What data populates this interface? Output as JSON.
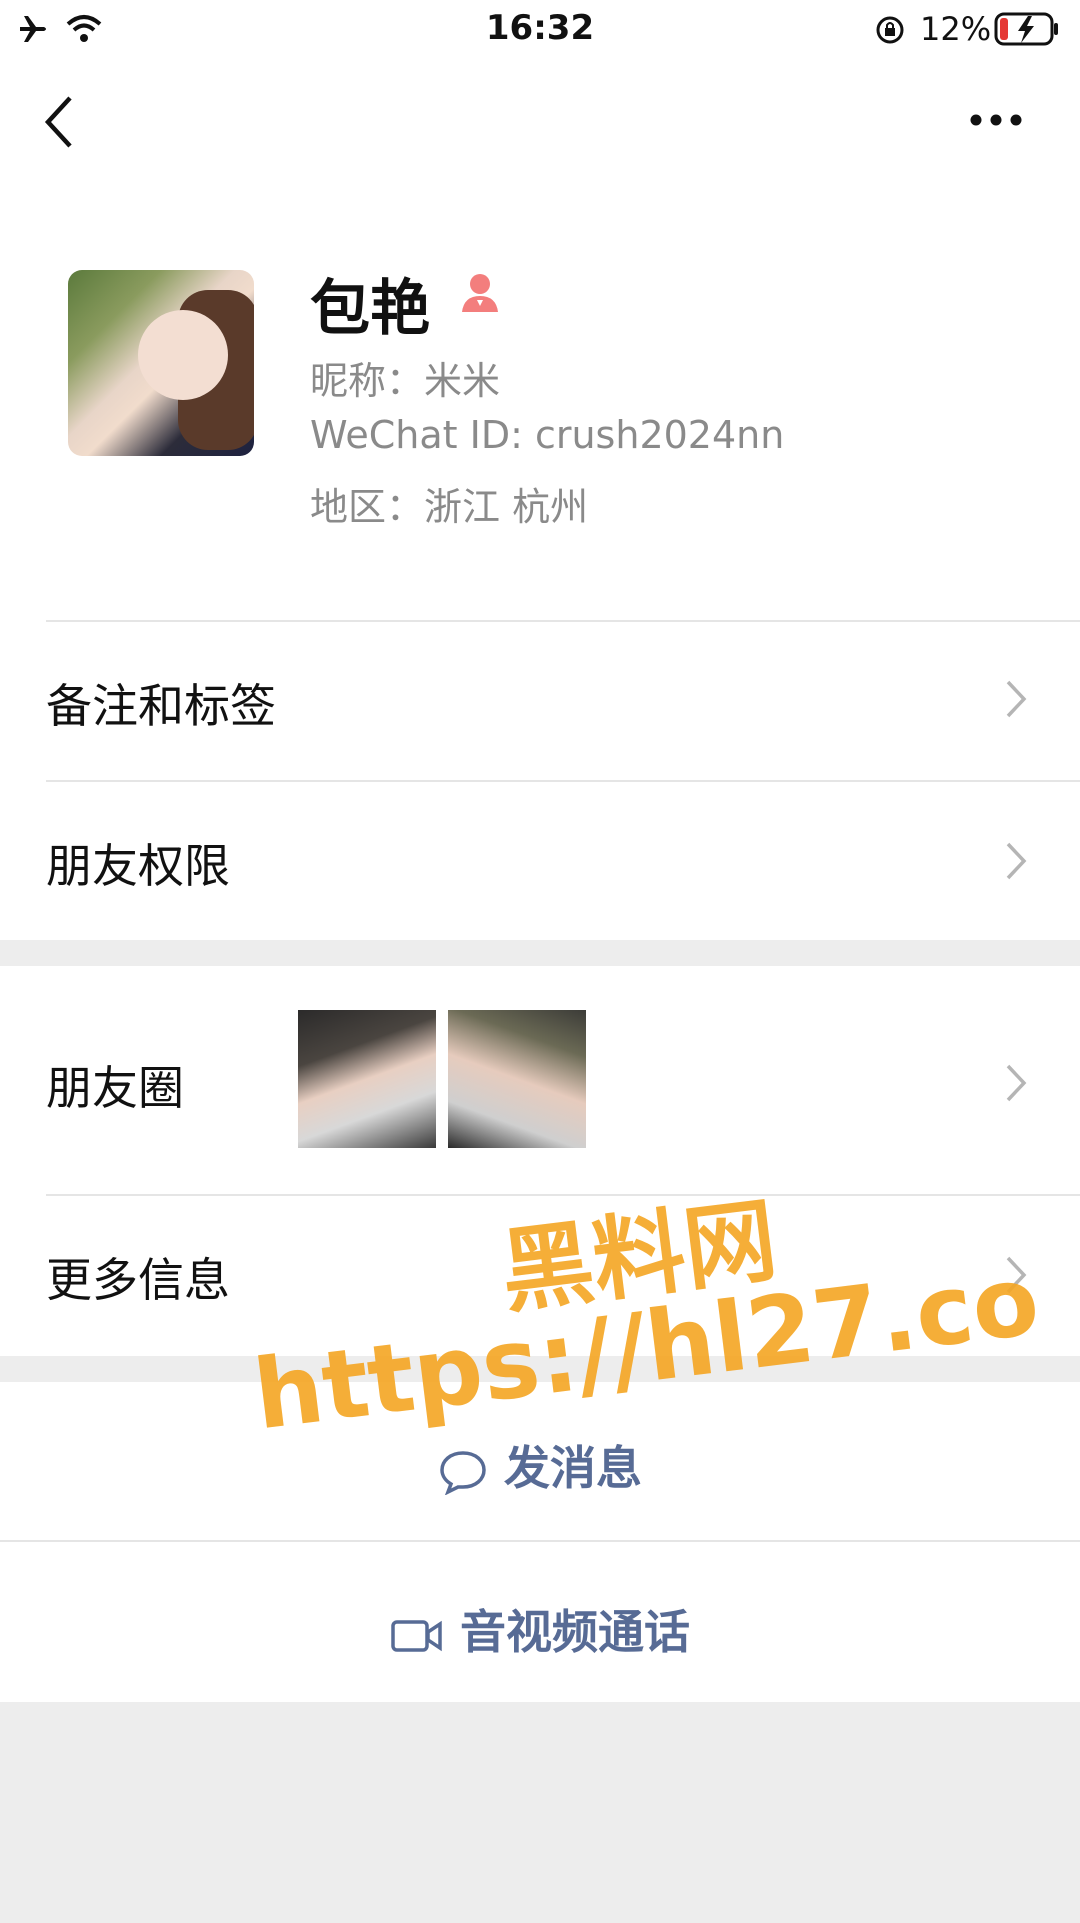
{
  "status_bar": {
    "time": "16:32",
    "battery_percent": "12%",
    "battery_level": 0.12
  },
  "nav": {
    "back_icon": "chevron-left-icon",
    "more_icon": "ellipsis-icon"
  },
  "profile": {
    "name": "包艳",
    "nickname": "昵称：米米",
    "wechat_id": "WeChat ID: crush2024nn",
    "region": "地区：浙江 杭州",
    "gender_icon": "female-icon",
    "gender_color": "#f37e7d"
  },
  "rows": {
    "remark_tags": "备注和标签",
    "permissions": "朋友权限",
    "moments": "朋友圈",
    "more_info": "更多信息"
  },
  "actions": {
    "send_message": "发消息",
    "av_call": "音视频通话",
    "link_color": "#576b95"
  },
  "watermark": {
    "line1": "黑料网",
    "line2": "https://hl27.co",
    "color": "#f5a623"
  }
}
